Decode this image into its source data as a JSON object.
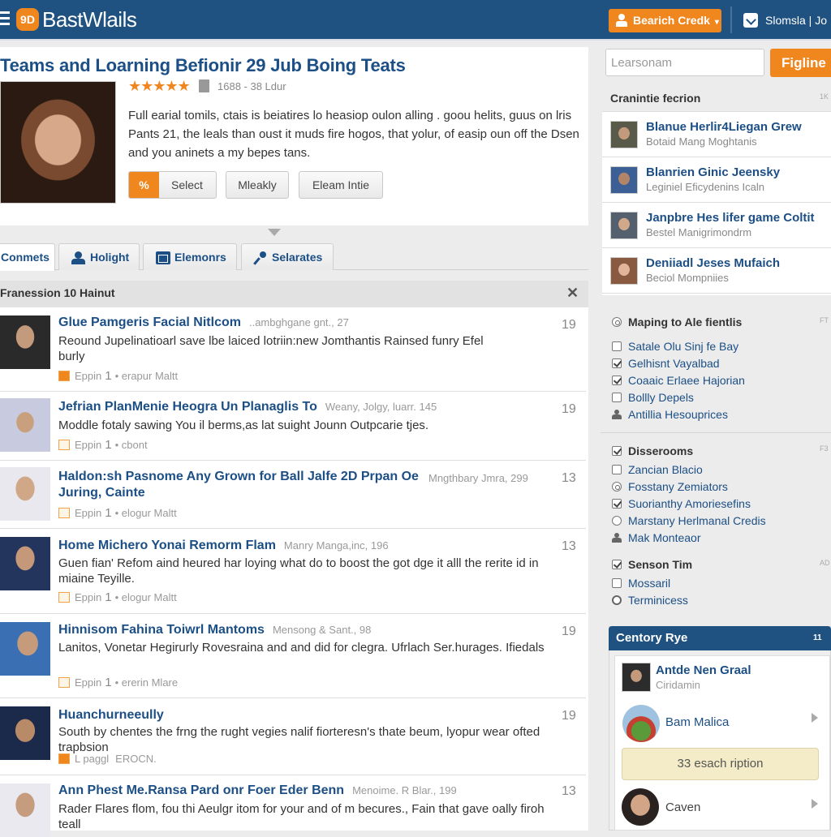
{
  "topbar": {
    "logo_mark": "9D",
    "logo_text": "BastWlails",
    "search_credit_label": "Bearich Credk",
    "signin_label": "Slomsla | Jo"
  },
  "hero": {
    "title": "Teams and Loarning Befionir 29 Jub Boing Teats",
    "stars": "★★★★★",
    "rating_out_of_5": 5,
    "rating_meta": "1688 - 38 Ldur",
    "description": "Full earial tomils, ctais is beiatires lo heasiop oulon alling . goou helits, guus on lris Pants 21, the leals than oust it muds fire hogos, that yolur, of easip oun off the Dsen and you aninets a my bepes tans.",
    "buttons": {
      "select_icon": "%",
      "select": "Select",
      "weekly": "Mleakly",
      "email": "Eleam Intie"
    }
  },
  "tabs": [
    {
      "label": "Conmets",
      "icon": "none",
      "active": true
    },
    {
      "label": "Holight",
      "icon": "person-icon",
      "active": false
    },
    {
      "label": "Elemonrs",
      "icon": "image-icon",
      "active": false
    },
    {
      "label": "Selarates",
      "icon": "key-icon",
      "active": false
    }
  ],
  "list": {
    "header": "Franession 10 Hainut",
    "close": "✕",
    "items": [
      {
        "title": "Glue Pamgeris Facial Nitlcom",
        "meta": "..ambghgane gnt., 27",
        "snippet": "Reound Jupelinatioarl save lbe laiced lotriin:new Jomthantis Rainsed funry Efel burly",
        "foot_label": "Eppin",
        "foot_count": "1",
        "foot_author": "• erapur Maltt",
        "count": "19"
      },
      {
        "title": "Jefrian PlanMenie Heogra Un Planaglis To",
        "meta": "Weany, Jolgy, luarr. 145",
        "snippet": "Moddle fotaly sawing You il berms,as lat suight Jounn Outpcarie tjes.",
        "foot_label": "Eppin",
        "foot_count": "1",
        "foot_author": "• cbont",
        "count": "19"
      },
      {
        "title": "Haldon:sh Pasnome Any Grown for Ball Jalfe 2D Prpan Oe Juring, Cainte",
        "meta": "Mngthbary Jmra, 299",
        "snippet": "",
        "foot_label": "Eppin",
        "foot_count": "1",
        "foot_author": "• elogur Maltt",
        "count": "13"
      },
      {
        "title": "Home Michero Yonai Remorm Flam",
        "meta": "Manry Manga,inc, 196",
        "snippet": "Guen fian' Refom aind heured har loying what do to boost the got dge it alll the rerite id in miaine Teyille.",
        "foot_label": "Eppin",
        "foot_count": "1",
        "foot_author": "• elogur Maltt",
        "count": "13"
      },
      {
        "title": "Hinnisom Fahina Toiwrl Mantoms",
        "meta": "Mensong & Sant., 98",
        "snippet": "Lanitos, Vonetar Hegirurly Rovesraina and and did for clegra. Ufrlach Ser.hurages. Ifiedals",
        "foot_label": "Eppin",
        "foot_count": "1",
        "foot_author": "• ererin Mlare",
        "count": "19"
      },
      {
        "title": "Huanchurneeully",
        "meta": "",
        "snippet": "South by chentes the frng the rught vegies nalif fiorteresn's thate beum, lyopur wear ofted trapbsion",
        "foot_label": "L paggl",
        "foot_count": "",
        "foot_author": "EROCN.",
        "count": "19"
      },
      {
        "title": "Ann Phest Me.Ransa Pard onr Foer Eder Benn",
        "meta": "Menoime. R Blar., 199",
        "snippet": "Rader Flares flom, fou thi Aeulgr itom for your and of m becures., Fain that gave oally firoh teall",
        "foot_label": "",
        "foot_count": "",
        "foot_author": "",
        "count": "13"
      }
    ]
  },
  "sidebar": {
    "search_placeholder": "Learsonam",
    "find_label": "Figline",
    "people_heading": "Cranintie fecrion",
    "people_mini": "1K",
    "people": [
      {
        "name": "Blanue Herlir4Liegan Grew",
        "sub": "Botaid Mang Moghtanis"
      },
      {
        "name": "Blanrien Ginic Jeensky",
        "sub": "Leginiel Eficydenins Icaln"
      },
      {
        "name": "Janpbre Hes lifer game Coltit",
        "sub": "Bestel Manigrimondrm"
      },
      {
        "name": "Deniiadl Jeses Mufaich",
        "sub": "Beciol Mompniies"
      }
    ],
    "filter_group_1": {
      "heading": "Maping to Ale fientlis",
      "mini": "FT",
      "items": [
        {
          "label": "Satale Olu Sinj fe Bay",
          "state": "unchecked"
        },
        {
          "label": "Gelhisnt Vayalbad",
          "state": "checked"
        },
        {
          "label": "Coaaic Erlaee Hajorian",
          "state": "checked"
        },
        {
          "label": "Bollly Depels",
          "state": "unchecked"
        },
        {
          "label": "Antillia Hesouprices",
          "state": "person"
        }
      ]
    },
    "filter_group_2": {
      "heading": "Disserooms",
      "mini": "F3",
      "items": [
        {
          "label": "Zancian Blacio",
          "state": "unchecked"
        },
        {
          "label": "Fosstany Zemiators",
          "state": "radio"
        },
        {
          "label": "Suorianthy Amoriesefins",
          "state": "checked"
        },
        {
          "label": "Marstany Herlmanal Credis",
          "state": "clock"
        },
        {
          "label": "Mak Monteaor",
          "state": "person"
        }
      ]
    },
    "filter_group_3": {
      "heading": "Senson Tim",
      "mini": "AD",
      "items": [
        {
          "label": "Mossaril",
          "state": "unchecked"
        },
        {
          "label": "Terminicess",
          "state": "bubble"
        }
      ]
    },
    "credit_panel": {
      "title": "Centory Rye",
      "count": "11",
      "featured_name": "Antde Nen Graal",
      "featured_sub": "Ciridamin",
      "row1": "Bam Malica",
      "subscribe": "33 esach ription",
      "row2": "Caven"
    }
  },
  "colors": {
    "brand_blue": "#1f5280",
    "accent_orange": "#f0861e",
    "link_blue": "#1c4f85"
  }
}
